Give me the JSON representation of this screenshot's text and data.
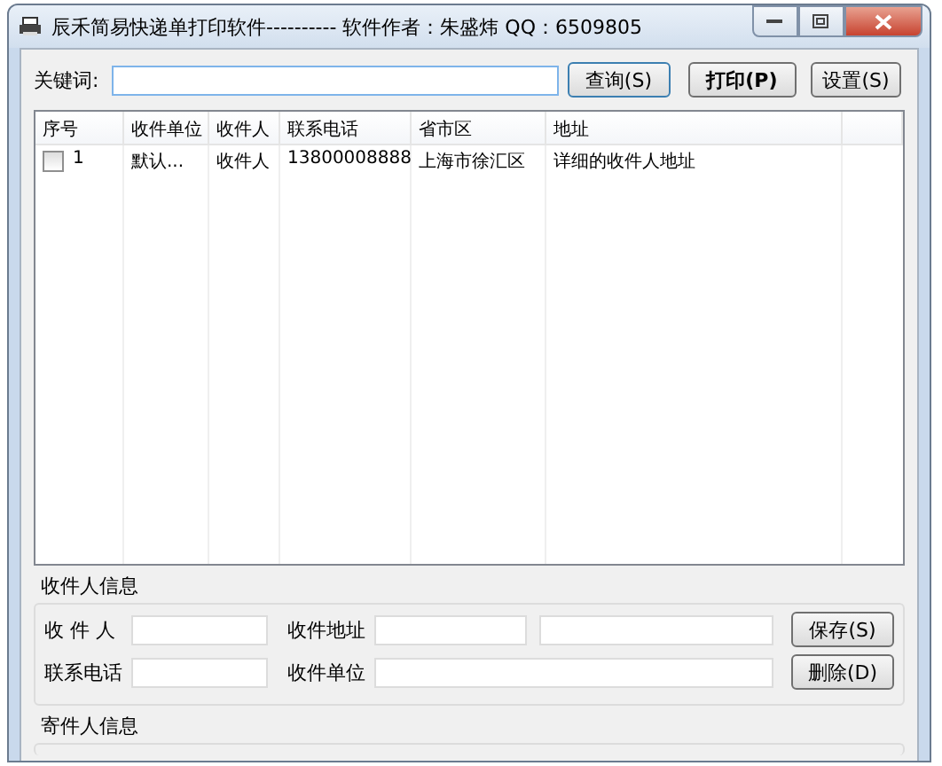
{
  "window": {
    "title": "辰禾简易快递单打印软件----------  软件作者：朱盛炜 QQ：6509805"
  },
  "search": {
    "label": "关键词:"
  },
  "buttons": [
    {
      "label": "查询(S)",
      "kind": "default"
    },
    {
      "label": "打印(P)",
      "kind": "bold"
    },
    {
      "label": "设置(S)",
      "kind": "normal"
    }
  ],
  "table": {
    "columns": [
      "序号",
      "收件单位",
      "收件人",
      "联系电话",
      "省市区",
      "地址"
    ],
    "rows": [
      {
        "checked": false,
        "cells": [
          "1",
          "默认...",
          "收件人",
          "13800008888",
          "上海市徐汇区",
          "详细的收件人地址"
        ]
      }
    ]
  },
  "recipient": {
    "title": "收件人信息",
    "name_label": "收 件 人",
    "address_label": "收件地址",
    "phone_label": "联系电话",
    "company_label": "收件单位",
    "save_button": "保存(S)",
    "delete_button": "删除(D)"
  },
  "sender": {
    "title": "寄件人信息"
  }
}
